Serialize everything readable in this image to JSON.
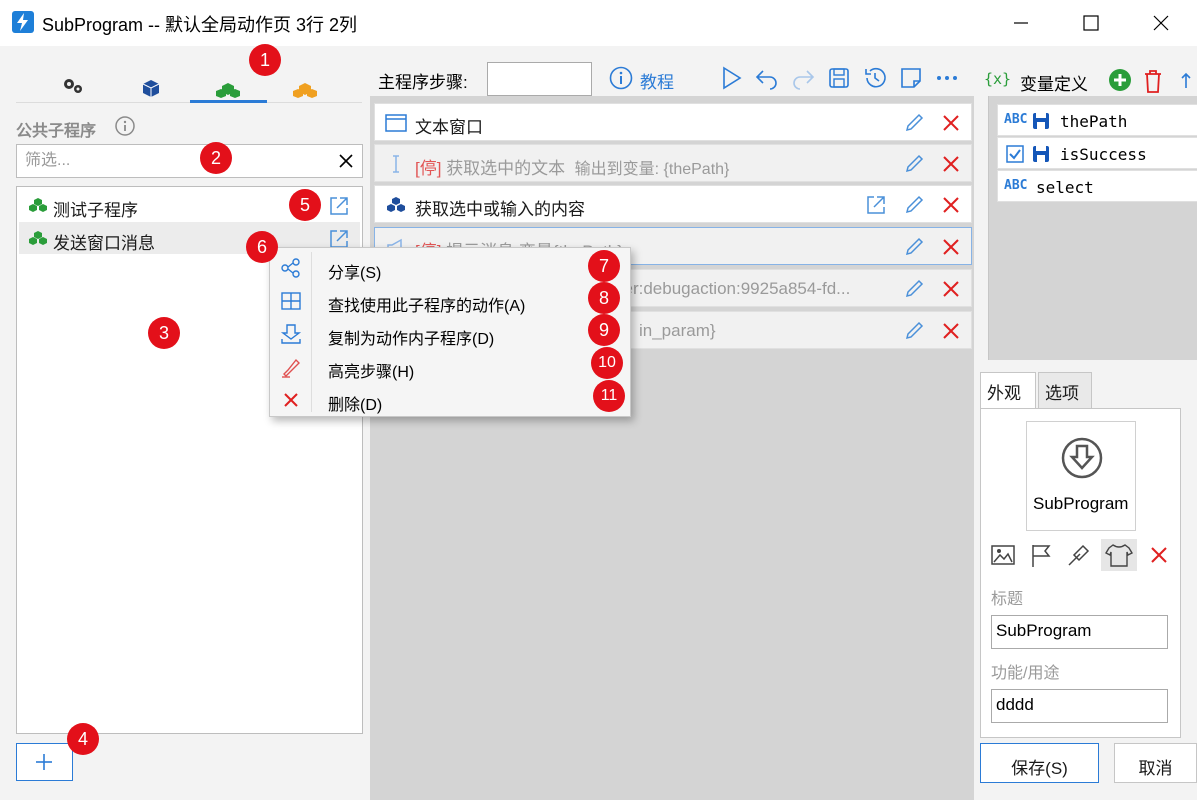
{
  "window": {
    "title": "SubProgram -- 默认全局动作页 3行 2列",
    "controls": [
      "minimize-icon",
      "maximize-icon",
      "close-icon"
    ]
  },
  "left": {
    "tabs": [
      "gears-icon",
      "cube-blue-icon",
      "cubes-green-icon",
      "cubes-orange-icon"
    ],
    "active_tab": 2,
    "public_label": "公共子程序",
    "filter_placeholder": "筛选...",
    "items": [
      {
        "label": "测试子程序"
      },
      {
        "label": "发送窗口消息"
      }
    ],
    "add_label": "+"
  },
  "middle": {
    "main_steps_label": "主程序步骤:",
    "main_steps_value": "",
    "tutorial_label": "教程",
    "steps": [
      {
        "prefix": "",
        "text": "文本窗口",
        "extra": "",
        "disabled": false,
        "icon": "window-icon"
      },
      {
        "prefix": "[停]",
        "text": "获取选中的文本",
        "extra": "输出到变量: {thePath}",
        "disabled": true,
        "icon": "text-cursor-icon"
      },
      {
        "prefix": "",
        "text": "获取选中或输入的内容",
        "extra": "",
        "disabled": false,
        "icon": "cubes-blue-icon"
      },
      {
        "prefix": "[停]",
        "text": "提示消息",
        "extra": "变量{thePath}",
        "disabled": true,
        "icon": "megaphone-icon"
      },
      {
        "prefix": "",
        "text": "",
        "extra": "ker:debugaction:9925a854-fd...",
        "disabled": true,
        "icon": ""
      },
      {
        "prefix": "",
        "text": "",
        "extra": "in_param}",
        "disabled": true,
        "icon": ""
      }
    ]
  },
  "context_menu": {
    "items": [
      {
        "label": "分享(S)",
        "icon": "share-icon"
      },
      {
        "label": "查找使用此子程序的动作(A)",
        "icon": "grid-icon"
      },
      {
        "label": "复制为动作内子程序(D)",
        "icon": "copy-download-icon"
      },
      {
        "label": "高亮步骤(H)",
        "icon": "highlighter-icon"
      },
      {
        "label": "删除(D)",
        "icon": "delete-x-icon"
      }
    ]
  },
  "right": {
    "var_header_icon": "{x}",
    "var_title": "变量定义",
    "variables": [
      {
        "type": "ABC",
        "name": "thePath",
        "saved": true,
        "checkbox": false
      },
      {
        "type": "check",
        "name": "isSuccess",
        "saved": true,
        "checkbox": true
      },
      {
        "type": "ABC",
        "name": "select",
        "saved": false,
        "checkbox": false
      }
    ],
    "tabs": [
      "外观",
      "选项"
    ],
    "preview_label": "SubProgram",
    "title_label": "标题",
    "title_value": "SubProgram",
    "purpose_label": "功能/用途",
    "purpose_value": "dddd",
    "save_label": "保存(S)",
    "cancel_label": "取消"
  },
  "badges": [
    "1",
    "2",
    "3",
    "4",
    "5",
    "6",
    "7",
    "8",
    "9",
    "10",
    "11"
  ],
  "colors": {
    "accent": "#2b7bd6",
    "badge": "#e3101a",
    "delete": "#e02020",
    "green": "#2a9d3a",
    "orange": "#f0a020"
  }
}
